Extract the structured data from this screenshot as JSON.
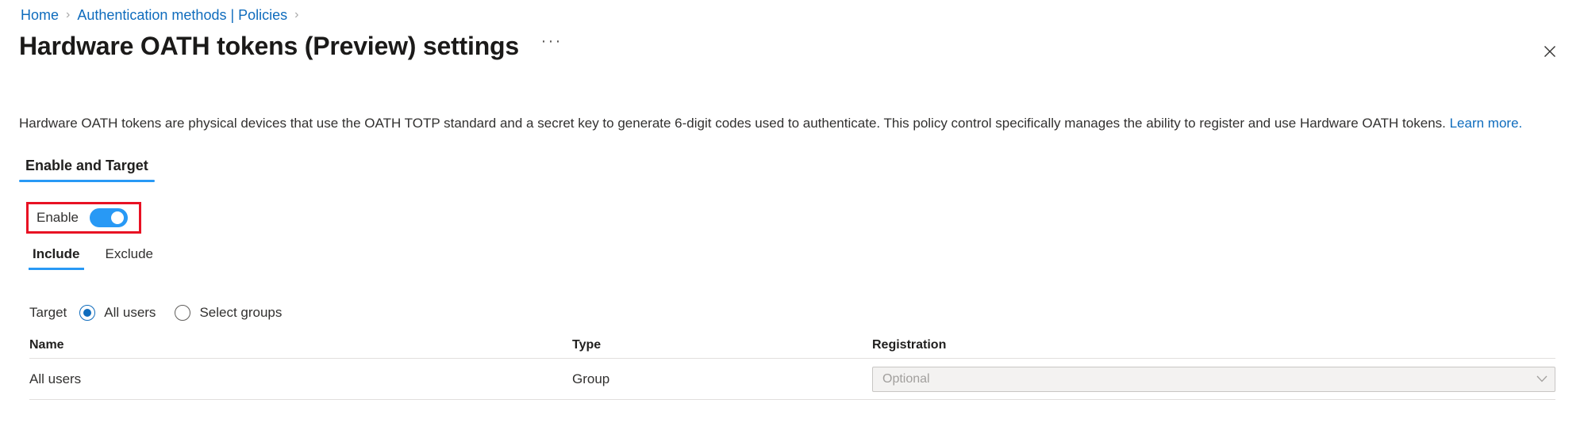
{
  "breadcrumb": {
    "items": [
      {
        "label": "Home"
      },
      {
        "label": "Authentication methods | Policies"
      }
    ],
    "separator": "›"
  },
  "header": {
    "title": "Hardware OATH tokens (Preview) settings",
    "more_options_label": "···",
    "more_options_icon": "ellipsis-icon",
    "close_icon": "close-icon"
  },
  "description": {
    "text": "Hardware OATH tokens are physical devices that use the OATH TOTP standard and a secret key to generate 6-digit codes used to authenticate. This policy control specifically manages the ability to register and use Hardware OATH tokens. ",
    "link_label": "Learn more."
  },
  "primary_tabs": [
    {
      "label": "Enable and Target",
      "active": true
    }
  ],
  "enable": {
    "label": "Enable",
    "toggle_state": "on",
    "highlight_color": "#e81123",
    "toggle_on_color": "#2899f5"
  },
  "secondary_tabs": [
    {
      "label": "Include",
      "active": true
    },
    {
      "label": "Exclude",
      "active": false
    }
  ],
  "target": {
    "label": "Target",
    "options": [
      {
        "label": "All users",
        "selected": true
      },
      {
        "label": "Select groups",
        "selected": false
      }
    ]
  },
  "table": {
    "columns": [
      {
        "label": "Name"
      },
      {
        "label": "Type"
      },
      {
        "label": "Registration"
      }
    ],
    "rows": [
      {
        "name": "All users",
        "type": "Group",
        "registration_value": "Optional",
        "registration_icon": "chevron-down-icon"
      }
    ]
  },
  "colors": {
    "link": "#0f6cbd",
    "accent": "#2899f5",
    "highlight": "#e81123",
    "text": "#323130",
    "border": "#e1dfdd"
  }
}
